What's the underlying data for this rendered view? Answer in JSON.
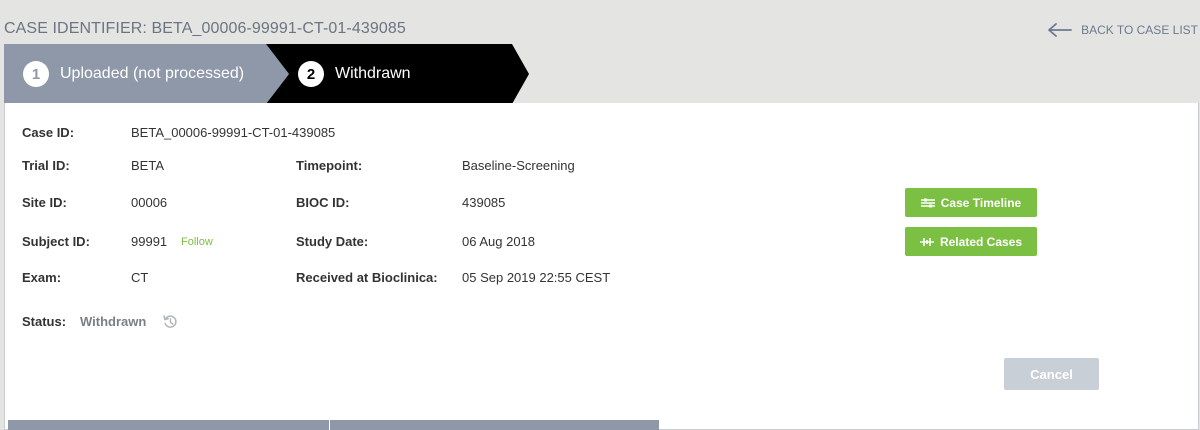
{
  "header": {
    "case_identifier": "CASE IDENTIFIER: BETA_00006-99991-CT-01-439085",
    "back_label": "BACK TO CASE LIST"
  },
  "steps": [
    {
      "number": "1",
      "label": "Uploaded (not processed)",
      "state": "completed"
    },
    {
      "number": "2",
      "label": "Withdrawn",
      "state": "active"
    }
  ],
  "details": {
    "case_id_label": "Case ID:",
    "case_id": "BETA_00006-99991-CT-01-439085",
    "trial_id_label": "Trial ID:",
    "trial_id": "BETA",
    "timepoint_label": "Timepoint:",
    "timepoint": "Baseline-Screening",
    "site_id_label": "Site ID:",
    "site_id": "00006",
    "bioc_id_label": "BIOC ID:",
    "bioc_id": "439085",
    "subject_id_label": "Subject ID:",
    "subject_id": "99991",
    "follow_label": "Follow",
    "study_date_label": "Study Date:",
    "study_date": "06 Aug 2018",
    "exam_label": "Exam:",
    "exam": "CT",
    "received_label": "Received at Bioclinica:",
    "received": "05 Sep 2019 22:55 CEST",
    "status_label": "Status:",
    "status": "Withdrawn"
  },
  "actions": {
    "case_timeline": "Case Timeline",
    "related_cases": "Related Cases",
    "cancel": "Cancel"
  },
  "icons": {
    "back": "arrow-left-icon",
    "history": "history-icon",
    "timeline": "timeline-icon",
    "related": "related-cases-icon"
  },
  "colors": {
    "step_completed": "#8e98a8",
    "step_active": "#000000",
    "action_green": "#7cc043",
    "follow_green": "#7cc040",
    "cancel_disabled": "#c9cfd6"
  }
}
